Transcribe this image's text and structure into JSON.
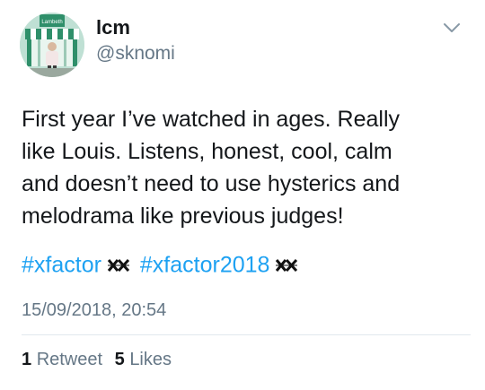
{
  "author": {
    "display_name": "lcm",
    "handle": "@sknomi",
    "avatar_caption": "Lambeth"
  },
  "menu_icon": "chevron-down-icon",
  "tweet": {
    "text_lines": [
      "First year I’ve watched in ages. Really",
      "like Louis. Listens, honest, cool, calm",
      "and doesn’t need to use hysterics and",
      "melodrama like previous judges!"
    ],
    "hashtags": [
      "#xfactor",
      "#xfactor2018"
    ],
    "hashtag_emoji": "x-factor-logo-icon"
  },
  "timestamp": "15/09/2018, 20:54",
  "stats": {
    "retweets_count": "1",
    "retweets_label": "Retweet",
    "likes_count": "5",
    "likes_label": "Likes"
  },
  "colors": {
    "link": "#1da1f2",
    "muted": "#657786",
    "text": "#14171a",
    "divider": "#e1e8ed"
  }
}
